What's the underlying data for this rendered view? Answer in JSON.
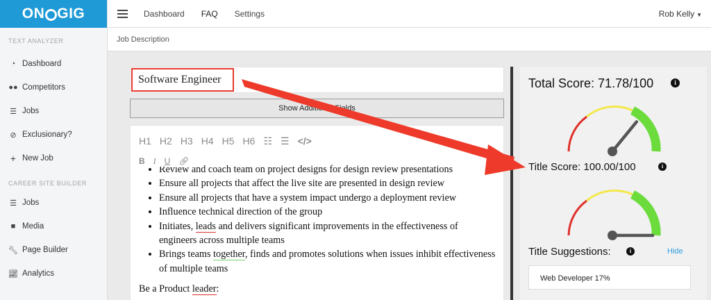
{
  "brand": {
    "logo": "ONGIG"
  },
  "sidebar": {
    "sections": [
      {
        "label": "TEXT ANALYZER",
        "items": [
          {
            "label": "Dashboard",
            "icon": "gauge-icon"
          },
          {
            "label": "Competitors",
            "icon": "users-icon"
          },
          {
            "label": "Jobs",
            "icon": "list-icon"
          },
          {
            "label": "Exclusionary?",
            "icon": "ban-icon"
          },
          {
            "label": "New Job",
            "icon": "plus-icon"
          }
        ]
      },
      {
        "label": "CAREER SITE BUILDER",
        "items": [
          {
            "label": "Jobs",
            "icon": "list-icon"
          },
          {
            "label": "Media",
            "icon": "video-icon"
          },
          {
            "label": "Page Builder",
            "icon": "wrench-icon"
          },
          {
            "label": "Analytics",
            "icon": "chart-icon"
          }
        ]
      }
    ]
  },
  "topbar": {
    "nav": [
      "Dashboard",
      "FAQ",
      "Settings"
    ],
    "user": "Rob Kelly"
  },
  "breadcrumb": "Job Description",
  "editor": {
    "title_value": "Software Engineer",
    "show_fields_label": "Show Additional Fields",
    "toolbar": [
      "H1",
      "H2",
      "H3",
      "H4",
      "H5",
      "H6"
    ],
    "partial_line": "Review and coach team on project designs for design review presentations",
    "bullets": {
      "b1": "Ensure all projects that affect the live site are presented in design review",
      "b2": "Ensure all projects that have a system impact undergo a deployment review",
      "b3": "Influence technical direction of the group",
      "b4_pre": "Initiates, ",
      "b4_word": "leads",
      "b4_post": " and delivers significant improvements in the effectiveness of engineers across multiple teams",
      "b5_pre": "Brings teams ",
      "b5_word": "together",
      "b5_post": ", finds and promotes solutions when issues inhibit effectiveness of multiple teams"
    },
    "para_pre": "Be a Product ",
    "para_word": "leader",
    "para_post": ":"
  },
  "scores": {
    "total_label": "Total Score: 71.78/100",
    "total_value": 71.78,
    "title_label": "Title Score: 100.00/100",
    "title_value": 100,
    "suggestions_label": "Title Suggestions:",
    "hide_label": "Hide",
    "suggestion": "Web Developer 17%"
  },
  "colors": {
    "brand": "#1f9ad6",
    "annotation": "#e53a2c",
    "gauge_red": "#e0302a",
    "gauge_yellow": "#f3e84a",
    "gauge_green": "#6bdc3c",
    "link": "#2f9ee0"
  }
}
